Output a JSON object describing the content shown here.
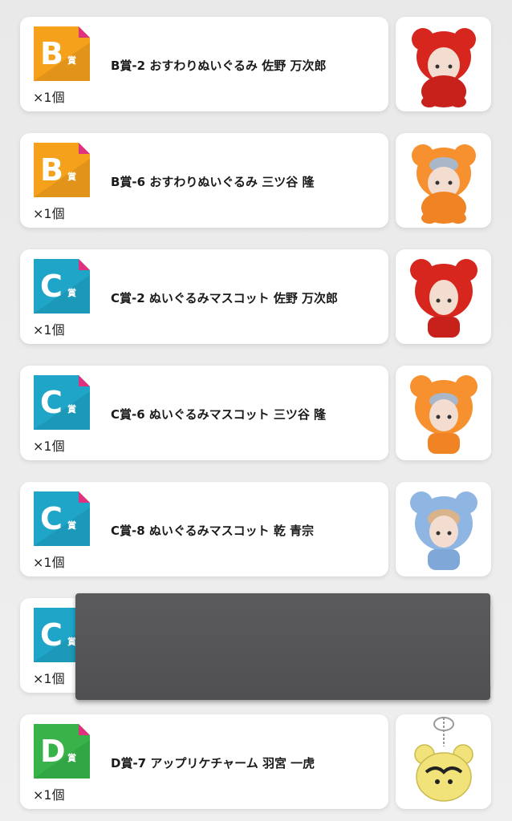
{
  "items": [
    {
      "tier_letter": "B",
      "tier_suffix": "賞",
      "tier_color": "#f5a11c",
      "quantity": "×1個",
      "title": "B賞-2 おすわりぬいぐるみ 佐野 万次郎",
      "thumb": "red-bear-plush"
    },
    {
      "tier_letter": "B",
      "tier_suffix": "賞",
      "tier_color": "#f5a11c",
      "quantity": "×1個",
      "title": "B賞-6 おすわりぬいぐるみ 三ツ谷 隆",
      "thumb": "orange-bear-plush"
    },
    {
      "tier_letter": "C",
      "tier_suffix": "賞",
      "tier_color": "#1fa5c8",
      "quantity": "×1個",
      "title": "C賞-2 ぬいぐるみマスコット 佐野 万次郎",
      "thumb": "red-bear-mascot"
    },
    {
      "tier_letter": "C",
      "tier_suffix": "賞",
      "tier_color": "#1fa5c8",
      "quantity": "×1個",
      "title": "C賞-6 ぬいぐるみマスコット 三ツ谷 隆",
      "thumb": "orange-bear-mascot"
    },
    {
      "tier_letter": "C",
      "tier_suffix": "賞",
      "tier_color": "#1fa5c8",
      "quantity": "×1個",
      "title": "C賞-8 ぬいぐるみマスコット 乾 青宗",
      "thumb": "blue-bear-mascot"
    },
    {
      "tier_letter": "C",
      "tier_suffix": "賞",
      "tier_color": "#1fa5c8",
      "quantity": "×1個",
      "title": "",
      "thumb": ""
    },
    {
      "tier_letter": "D",
      "tier_suffix": "賞",
      "tier_color": "#37b34a",
      "quantity": "×1個",
      "title": "D賞-7 アップリケチャーム 羽宮 一虎",
      "thumb": "yellow-charm"
    }
  ]
}
